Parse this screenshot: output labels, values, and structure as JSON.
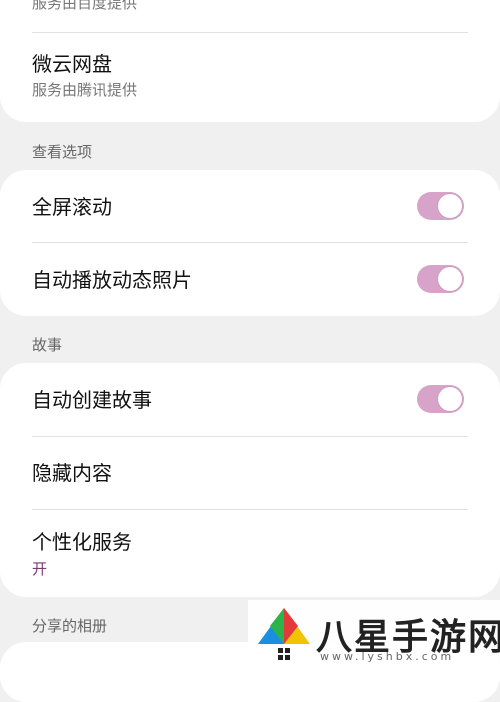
{
  "cloud_card": {
    "baidu_subtitle": "服务由百度提供",
    "weiyun_title": "微云网盘",
    "weiyun_subtitle": "服务由腾讯提供"
  },
  "view_options": {
    "header": "查看选项",
    "items": [
      {
        "label": "全屏滚动",
        "toggle_on": true
      },
      {
        "label": "自动播放动态照片",
        "toggle_on": true
      }
    ]
  },
  "stories": {
    "header": "故事",
    "auto_create": {
      "label": "自动创建故事",
      "toggle_on": true
    },
    "hide_content": {
      "label": "隐藏内容"
    },
    "personalized": {
      "label": "个性化服务",
      "value": "开"
    }
  },
  "shared_albums": {
    "header": "分享的相册"
  },
  "watermark": {
    "text": "八星手游网",
    "url": "www.lyshbx.com"
  },
  "colors": {
    "background": "#f0f0f0",
    "card": "#ffffff",
    "toggle_on": "#d7a3c8",
    "accent_value": "#7a3a72"
  }
}
